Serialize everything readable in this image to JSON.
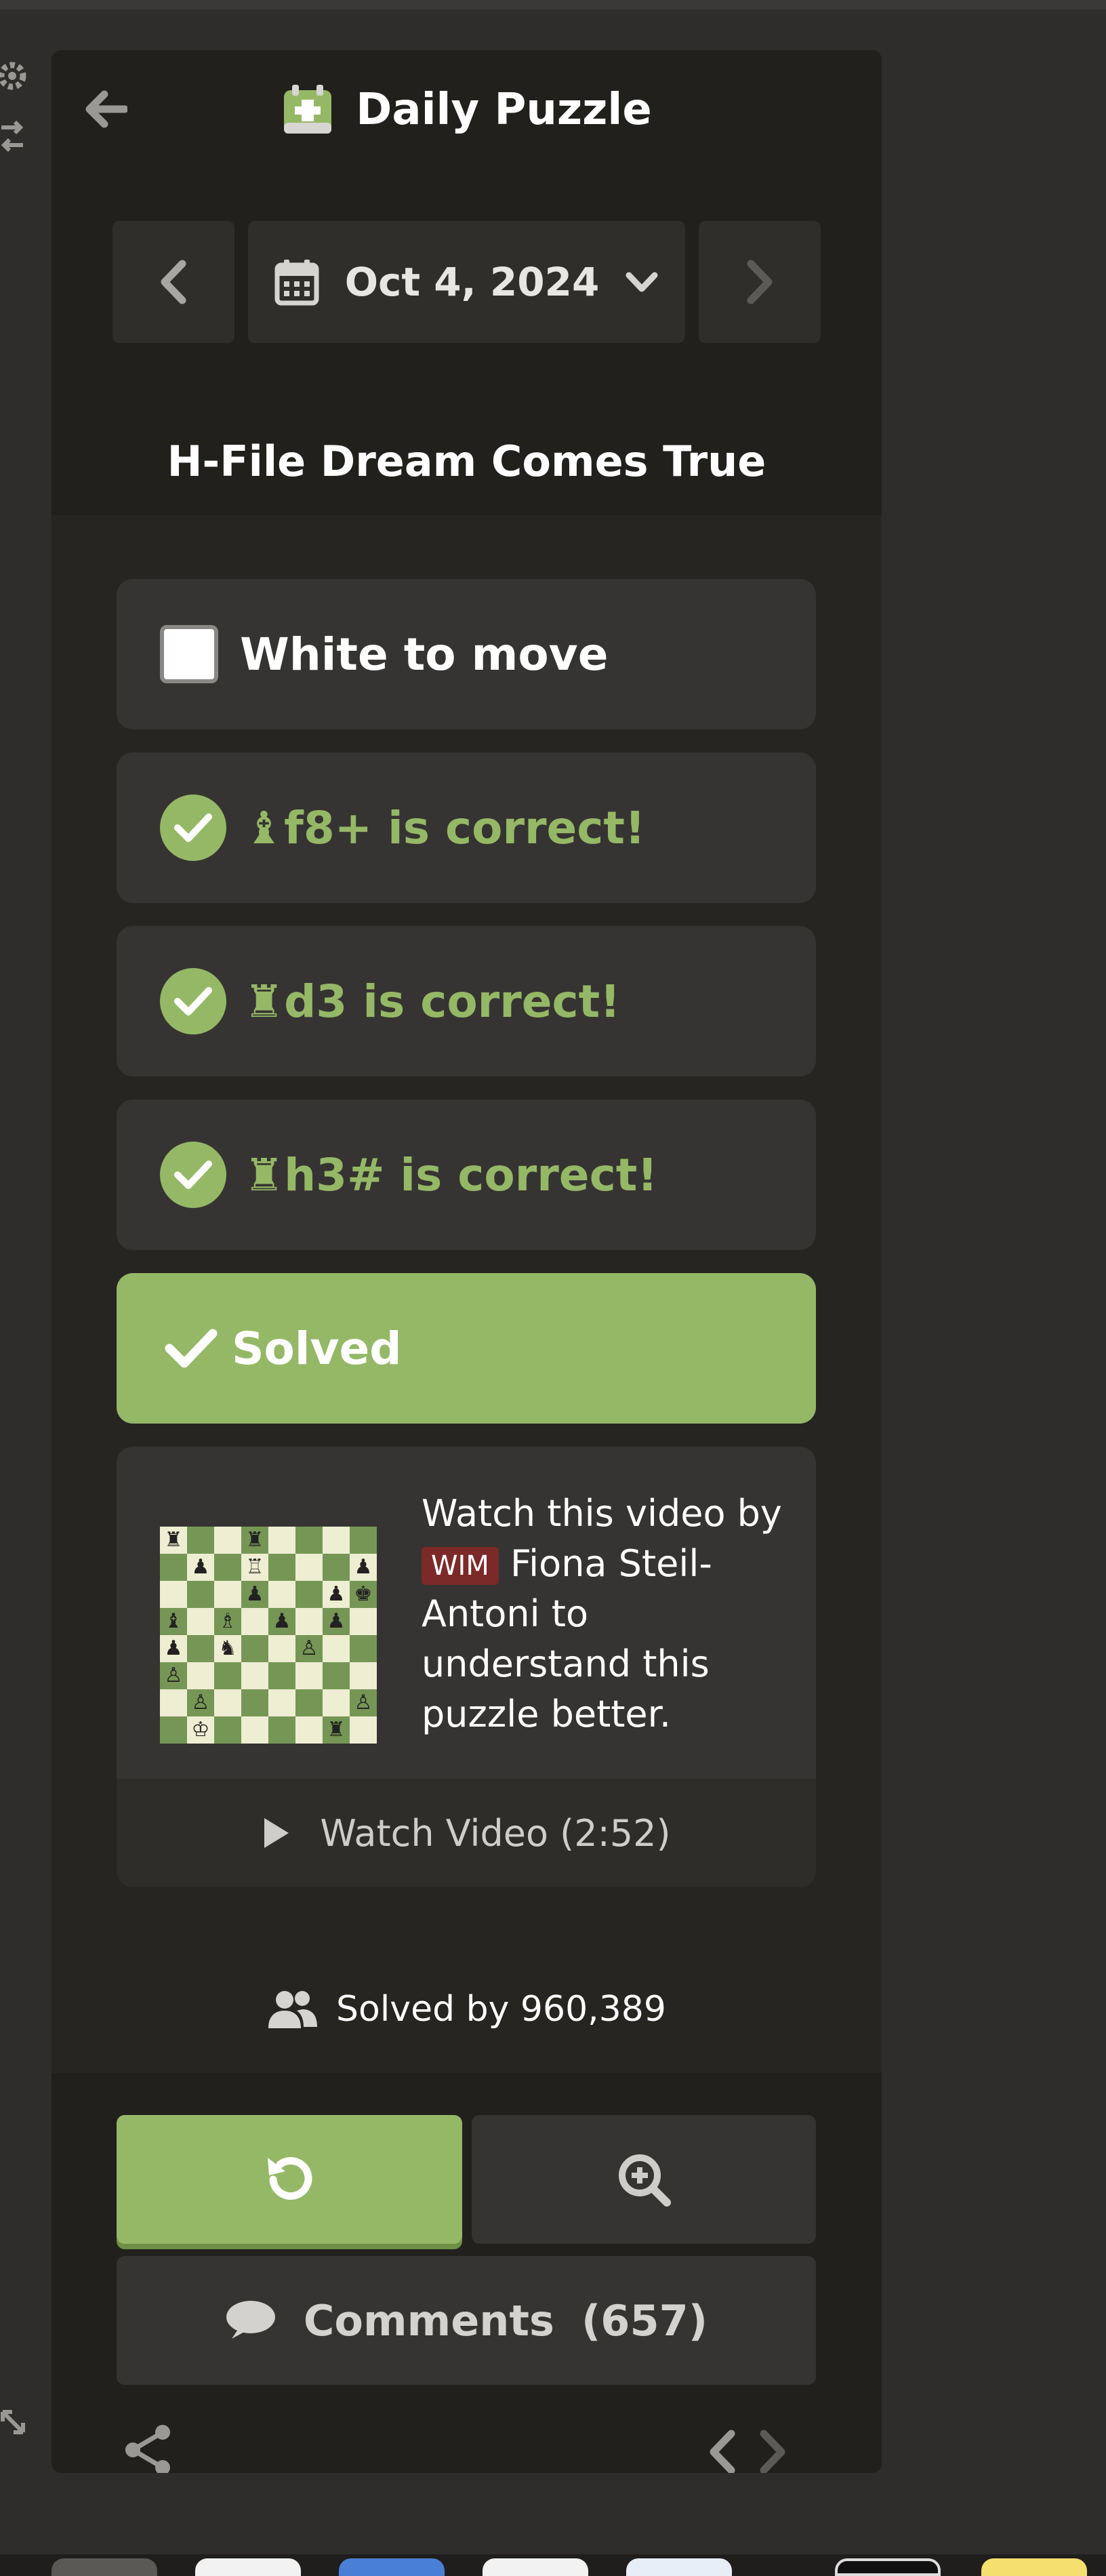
{
  "header": {
    "title": "Daily Puzzle"
  },
  "date_nav": {
    "date": "Oct 4, 2024"
  },
  "puzzle": {
    "title": "H-File Dream Comes True"
  },
  "status": {
    "to_move": "White to move",
    "moves": [
      {
        "piece": "♝",
        "text": "f8+ is correct!"
      },
      {
        "piece": "♜",
        "text": "d3 is correct!"
      },
      {
        "piece": "♜",
        "text": "h3# is correct!"
      }
    ],
    "solved_label": "Solved"
  },
  "video": {
    "text_before": "Watch this video by",
    "title_badge": "WIM",
    "text_after": "Fiona Steil-Antoni to understand this puzzle better.",
    "watch_label": "Watch Video (2:52)"
  },
  "stats": {
    "solved_by": "Solved by 960,389"
  },
  "actions": {
    "comments_label": "Comments",
    "comments_count": "(657)"
  },
  "colors": {
    "accent": "#95b866",
    "panel": "#262522",
    "card": "#363432",
    "badge": "#7c2929"
  },
  "icons": [
    "arrow-left-icon",
    "daily-puzzle-icon",
    "chevron-left-icon",
    "calendar-icon",
    "chevron-down-icon",
    "chevron-right-icon",
    "checkbox-icon",
    "check-circle-icon",
    "checkmark-icon",
    "play-icon",
    "users-icon",
    "retry-icon",
    "analysis-icon",
    "comment-icon",
    "share-icon"
  ],
  "board": [
    [
      "♜",
      "",
      "",
      "♜",
      "",
      "",
      "",
      ""
    ],
    [
      "",
      "♟",
      "",
      "♖",
      "",
      "",
      "",
      "♟"
    ],
    [
      "",
      "",
      "",
      "♟",
      "",
      "",
      "♟",
      "♚"
    ],
    [
      "♝",
      "",
      "♗",
      "",
      "♟",
      "",
      "♟",
      ""
    ],
    [
      "♟",
      "",
      "♞",
      "",
      "",
      "♙",
      "",
      ""
    ],
    [
      "♙",
      "",
      "",
      "",
      "",
      "",
      "",
      ""
    ],
    [
      "",
      "♙",
      "",
      "",
      "",
      "",
      "",
      "♙"
    ],
    [
      "",
      "♔",
      "",
      "",
      "",
      "",
      "♜",
      ""
    ]
  ]
}
